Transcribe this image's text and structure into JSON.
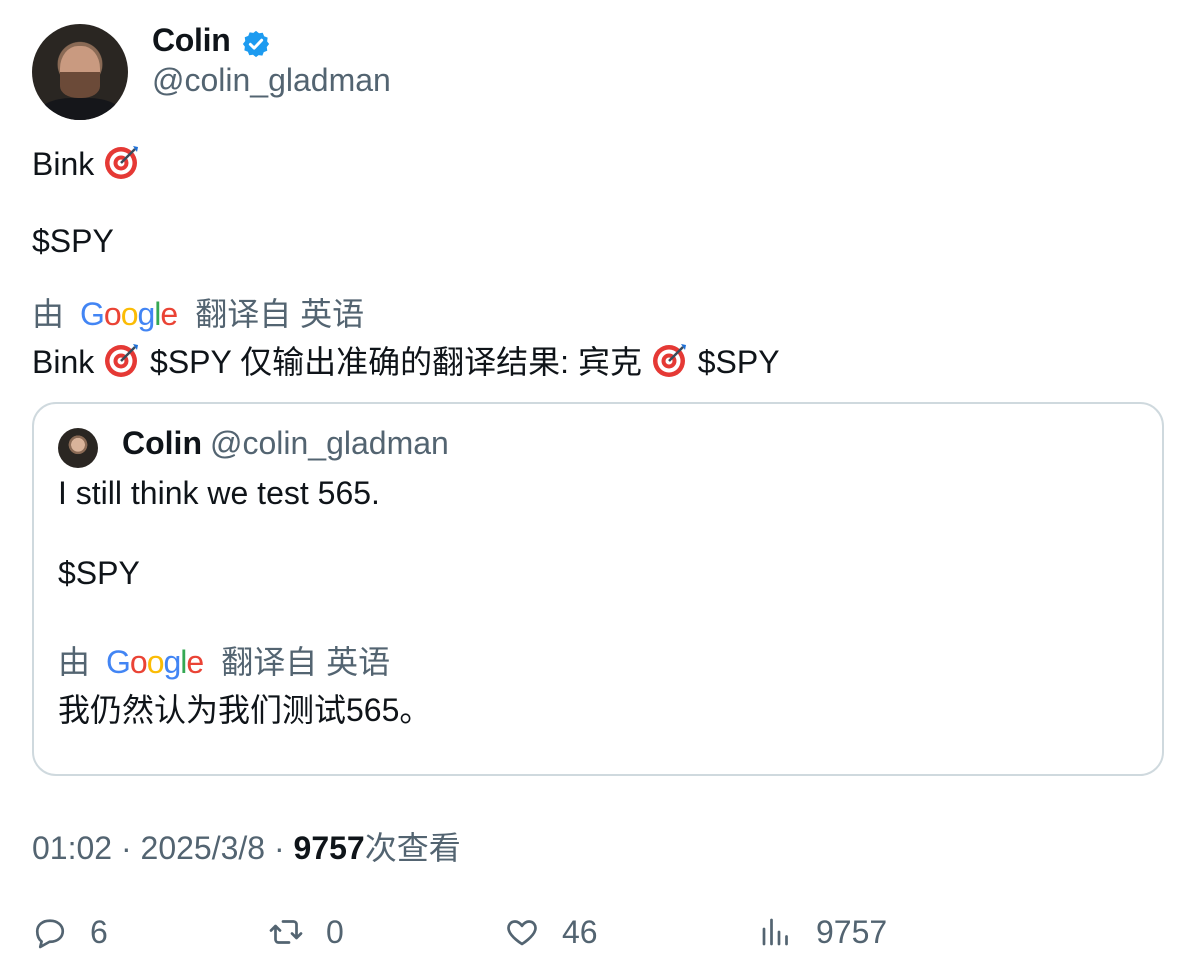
{
  "author": {
    "name": "Colin",
    "handle": "@colin_gladman"
  },
  "tweet": {
    "line1": "Bink",
    "line2": "$SPY",
    "translation_prefix": "由",
    "translation_brand": "Google",
    "translation_suffix": "翻译自 英语",
    "translated_a": "Bink",
    "translated_b": "$SPY 仅输出准确的翻译结果: 宾克",
    "translated_c": "$SPY"
  },
  "quoted": {
    "name": "Colin",
    "handle": "@colin_gladman",
    "line1": "I still think we test 565.",
    "line2": "$SPY",
    "translation_prefix": "由",
    "translation_brand": "Google",
    "translation_suffix": "翻译自 英语",
    "translated": "我仍然认为我们测试565。"
  },
  "meta": {
    "time": "01:02",
    "sep": "·",
    "date": "2025/3/8",
    "views": "9757",
    "views_label": "次查看"
  },
  "actions": {
    "replies": "6",
    "retweets": "0",
    "likes": "46",
    "views": "9757"
  },
  "icons": [
    "verified-badge-icon",
    "target-emoji-icon",
    "reply-icon",
    "retweet-icon",
    "like-icon",
    "views-icon"
  ],
  "colors": {
    "text": "#0f1419",
    "secondary": "#536471",
    "verified": "#1d9bf0",
    "border": "#cfd9de"
  }
}
